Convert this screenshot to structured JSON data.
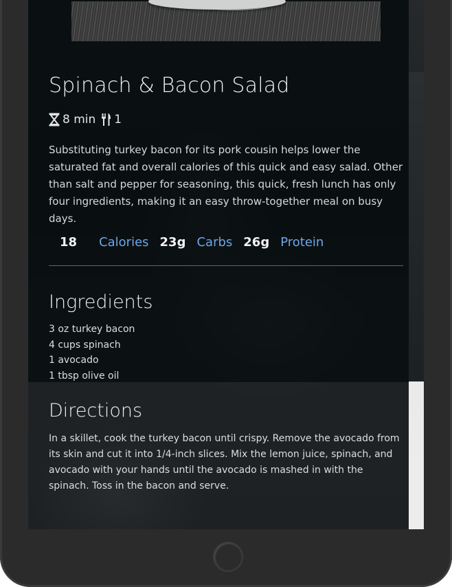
{
  "recipe": {
    "title": "Spinach & Bacon Salad",
    "time": "8 min",
    "servings": "1",
    "description": "Substituting turkey bacon for its pork cousin helps lower the saturated fat and overall calories of this quick and easy salad. Other than salt and pepper for seasoning, this quick, fresh lunch has only four ingredients, making it an easy throw-together meal on busy days.",
    "nutrition": {
      "calories_value": "18",
      "calories_label": "Calories",
      "carbs_value": "23g",
      "carbs_label": "Carbs",
      "protein_value": "26g",
      "protein_label": "Protein"
    },
    "ingredients_heading": "Ingredients",
    "ingredients": [
      "3 oz turkey bacon",
      "4 cups spinach",
      "1 avocado",
      "1 tbsp olive oil"
    ],
    "directions_heading": "Directions",
    "directions": "In a skillet, cook the turkey bacon until crispy. Remove the avocado from its skin and cut it into 1/4-inch slices. Mix the lemon juice, spinach, and avocado with your hands until the avocado is mashed in with the spinach. Toss in the bacon and serve."
  },
  "icons": {
    "time": "hourglass-icon",
    "servings": "fork-knife-icon"
  },
  "colors": {
    "accent": "#6fa6e8",
    "divider": "#4f6a86"
  }
}
